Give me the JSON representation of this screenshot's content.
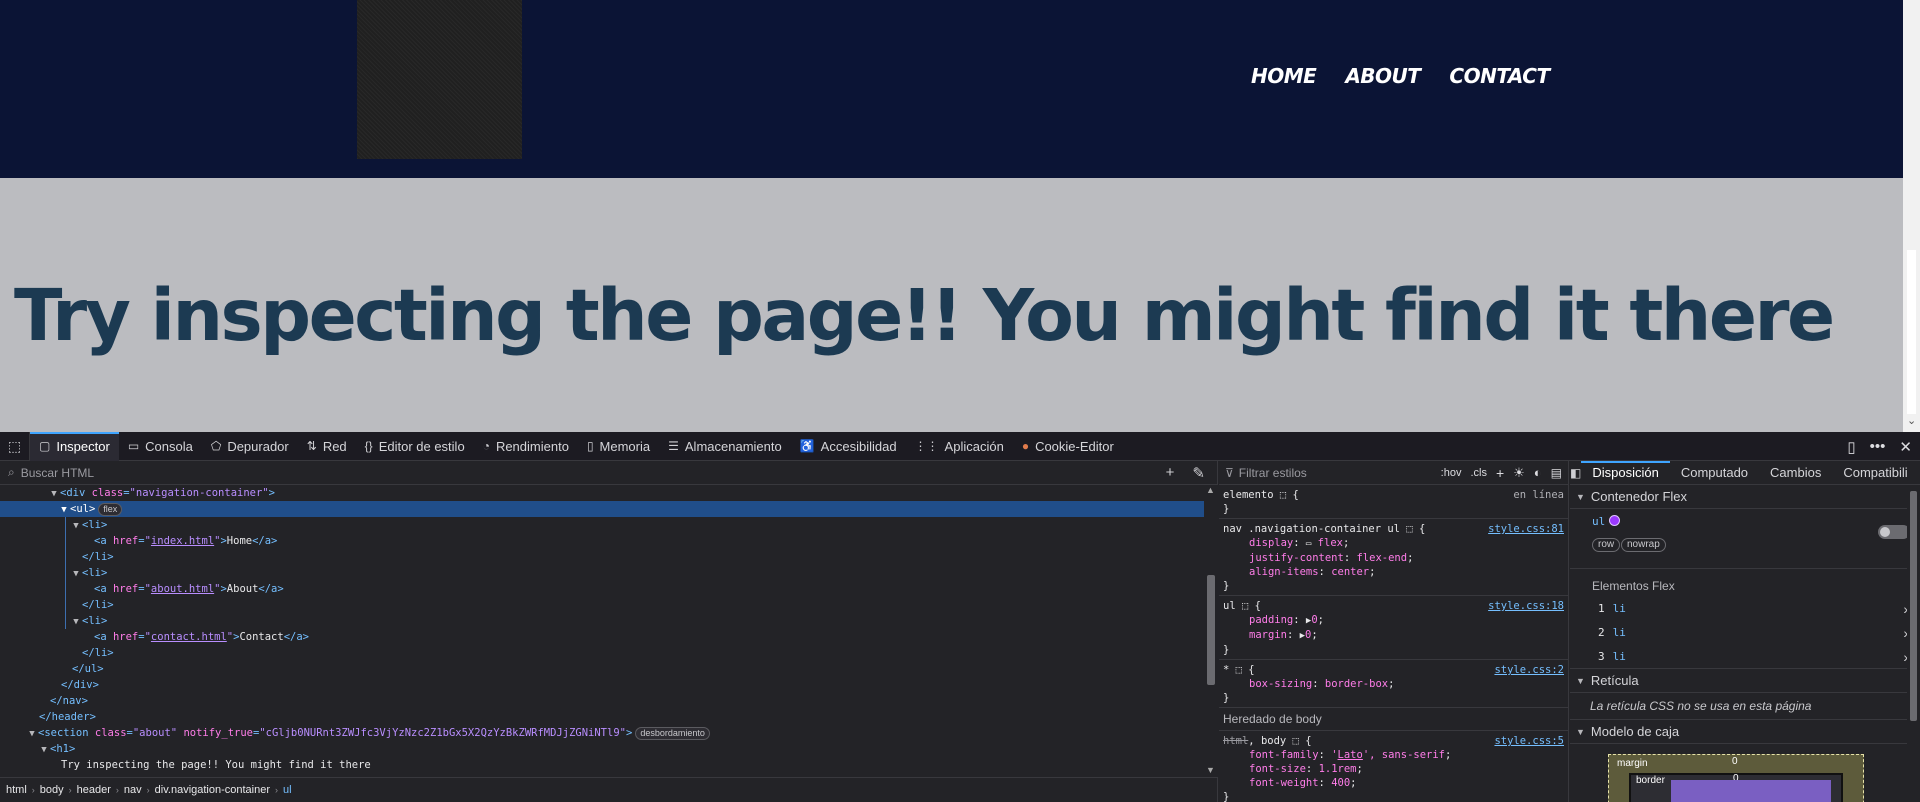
{
  "site": {
    "nav": [
      "HOME",
      "ABOUT",
      "CONTACT"
    ],
    "heading": "Try inspecting the page!! You might find it there"
  },
  "devtools": {
    "tabs": [
      {
        "label": "Inspector",
        "icon": "inspector-icon"
      },
      {
        "label": "Consola",
        "icon": "console-icon"
      },
      {
        "label": "Depurador",
        "icon": "debugger-icon"
      },
      {
        "label": "Red",
        "icon": "network-icon"
      },
      {
        "label": "Editor de estilo",
        "icon": "style-editor-icon"
      },
      {
        "label": "Rendimiento",
        "icon": "performance-icon"
      },
      {
        "label": "Memoria",
        "icon": "memory-icon"
      },
      {
        "label": "Almacenamiento",
        "icon": "storage-icon"
      },
      {
        "label": "Accesibilidad",
        "icon": "accessibility-icon"
      },
      {
        "label": "Aplicación",
        "icon": "application-icon"
      },
      {
        "label": "Cookie-Editor",
        "icon": "cookie-icon"
      }
    ],
    "html_search_placeholder": "Buscar HTML",
    "markup": {
      "div_open": "<div class=\"navigation-container\">",
      "ul_open": "<ul>",
      "flex_badge": "flex",
      "li_open": "<li>",
      "li_close": "</li>",
      "links": [
        {
          "href": "index.html",
          "text": "Home"
        },
        {
          "href": "about.html",
          "text": "About"
        },
        {
          "href": "contact.html",
          "text": "Contact"
        }
      ],
      "ul_close": "</ul>",
      "div_close": "</div>",
      "nav_close": "</nav>",
      "header_close": "</header>",
      "section_class": "about",
      "section_attr": "notify_true",
      "section_attr_value": "cGljb0NURnt3ZWJfc3VjYzNzc2Z1bGx5X2QzYzBkZWRfMDJjZGNiNTl9",
      "overflow_badge": "desbordamiento",
      "h1_open": "<h1>",
      "h1_text": "Try inspecting the page!! You might find it there"
    },
    "breadcrumbs": [
      "html",
      "body",
      "header",
      "nav",
      "div.navigation-container",
      "ul"
    ],
    "rules": {
      "filter_placeholder": "Filtrar estilos",
      "hov": ":hov",
      "cls": ".cls",
      "element_selector": "elemento",
      "element_source": "en línea",
      "rule1_selector": "nav .navigation-container ul",
      "rule1_source": "style.css:81",
      "rule1_decls": [
        {
          "prop": "display",
          "value": "flex"
        },
        {
          "prop": "justify-content",
          "value": "flex-end"
        },
        {
          "prop": "align-items",
          "value": "center"
        }
      ],
      "rule2_selector": "ul",
      "rule2_source": "style.css:18",
      "rule2_decls": [
        {
          "prop": "padding",
          "value": "0"
        },
        {
          "prop": "margin",
          "value": "0"
        }
      ],
      "rule3_selector": "*",
      "rule3_source": "style.css:2",
      "rule3_decls": [
        {
          "prop": "box-sizing",
          "value": "border-box"
        }
      ],
      "inherited_header": "Heredado de body",
      "rule4_selector_struck": "html",
      "rule4_selector": ", body",
      "rule4_source": "style.css:5",
      "rule4_decls": [
        {
          "prop": "font-family",
          "value_pre": "'",
          "value_font": "Lato",
          "value_post": "', sans-serif"
        },
        {
          "prop": "font-size",
          "value": "1.1rem"
        },
        {
          "prop": "font-weight",
          "value": "400"
        }
      ]
    },
    "layout": {
      "tabs": [
        "Disposición",
        "Computado",
        "Cambios",
        "Compatibili"
      ],
      "flex_container_title": "Contenedor Flex",
      "flex_selector": "ul",
      "pill_row": "row",
      "pill_nowrap": "nowrap",
      "flex_items_title": "Elementos Flex",
      "flex_items": [
        {
          "index": "1",
          "name": "li"
        },
        {
          "index": "2",
          "name": "li"
        },
        {
          "index": "3",
          "name": "li"
        }
      ],
      "grid_title": "Retícula",
      "grid_msg": "La retícula CSS no se usa en esta página",
      "boxmodel_title": "Modelo de caja",
      "bm_margin_label": "margin",
      "bm_margin_value": "0",
      "bm_border_label": "border",
      "bm_border_value": "0"
    }
  }
}
